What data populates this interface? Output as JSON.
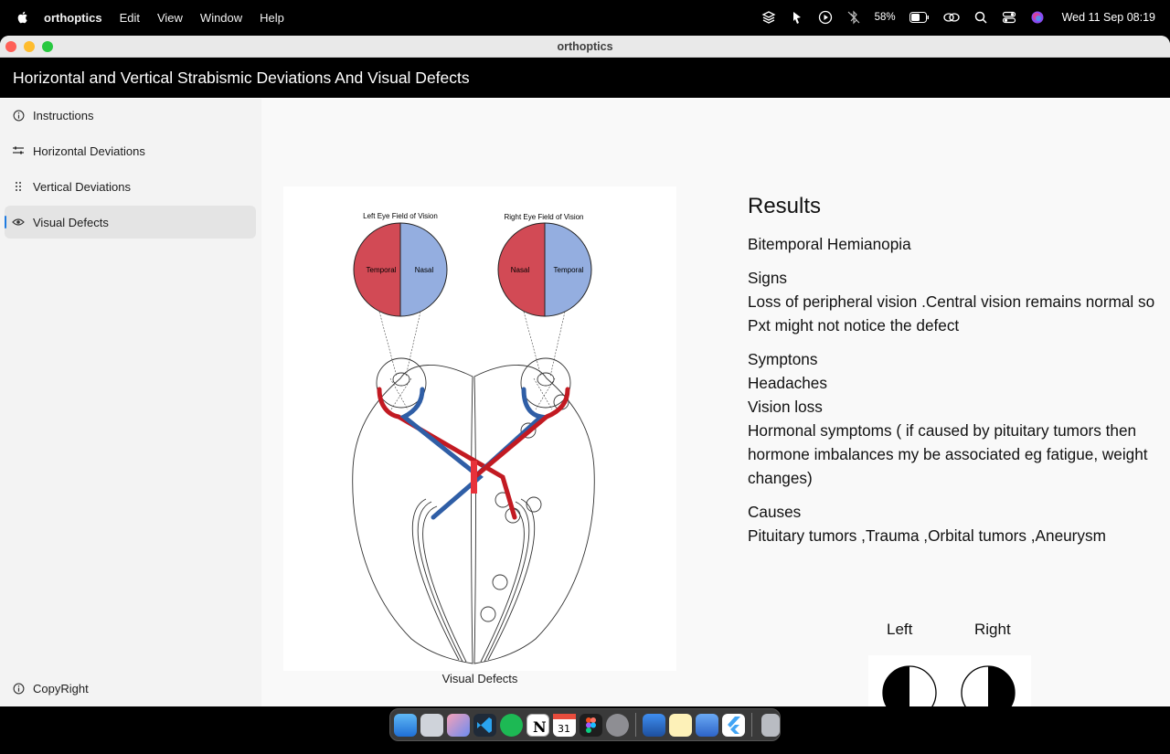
{
  "menubar": {
    "app_name": "orthoptics",
    "items": [
      "Edit",
      "View",
      "Window",
      "Help"
    ],
    "battery": "58%",
    "clock": "Wed 11 Sep  08:19"
  },
  "window": {
    "title": "orthoptics",
    "header": "Horizontal and Vertical Strabismic Deviations And Visual Defects"
  },
  "sidebar": {
    "items": [
      {
        "label": "Instructions",
        "icon": "info-icon"
      },
      {
        "label": "Horizontal Deviations",
        "icon": "sliders-icon"
      },
      {
        "label": "Vertical Deviations",
        "icon": "grip-icon"
      },
      {
        "label": "Visual Defects",
        "icon": "eye-icon",
        "active": true
      }
    ],
    "footer": {
      "label": "CopyRight",
      "icon": "info-icon"
    }
  },
  "figure": {
    "caption": "Visual Defects",
    "left_title": "Left Eye Field of Vision",
    "right_title": "Right Eye Field of Vision",
    "left_temporal": "Temporal",
    "left_nasal": "Nasal",
    "right_nasal": "Nasal",
    "right_temporal": "Temporal",
    "colors": {
      "temporal": "#d24a55",
      "nasal": "#94aee0",
      "tract_blue": "#2f5ea6",
      "tract_red": "#c21a22"
    }
  },
  "results": {
    "heading": "Results",
    "diagnosis": "Bitemporal Hemianopia",
    "signs_title": "Signs",
    "signs": "Loss of peripheral vision .Central vision remains normal so Pxt might not notice the defect",
    "symptoms_title": "Symptons",
    "symptoms": [
      "Headaches",
      "Vision loss",
      "Hormonal symptoms ( if caused by pituitary tumors then hormone imbalances my be associated eg fatigue, weight changes)"
    ],
    "causes_title": "Causes",
    "causes": "Pituitary tumors ,Trauma ,Orbital tumors ,Aneurysm"
  },
  "fields": {
    "left_label": "Left",
    "right_label": "Right"
  },
  "dock": {
    "apps": [
      "finder-icon",
      "launchpad-icon",
      "app-icon",
      "vscode-icon",
      "spotify-icon",
      "notion-icon",
      "calendar-icon",
      "figma-icon",
      "settings-icon",
      "xcode-icon",
      "notes-icon",
      "simulator-icon",
      "flutter-icon",
      "trash-icon"
    ]
  }
}
